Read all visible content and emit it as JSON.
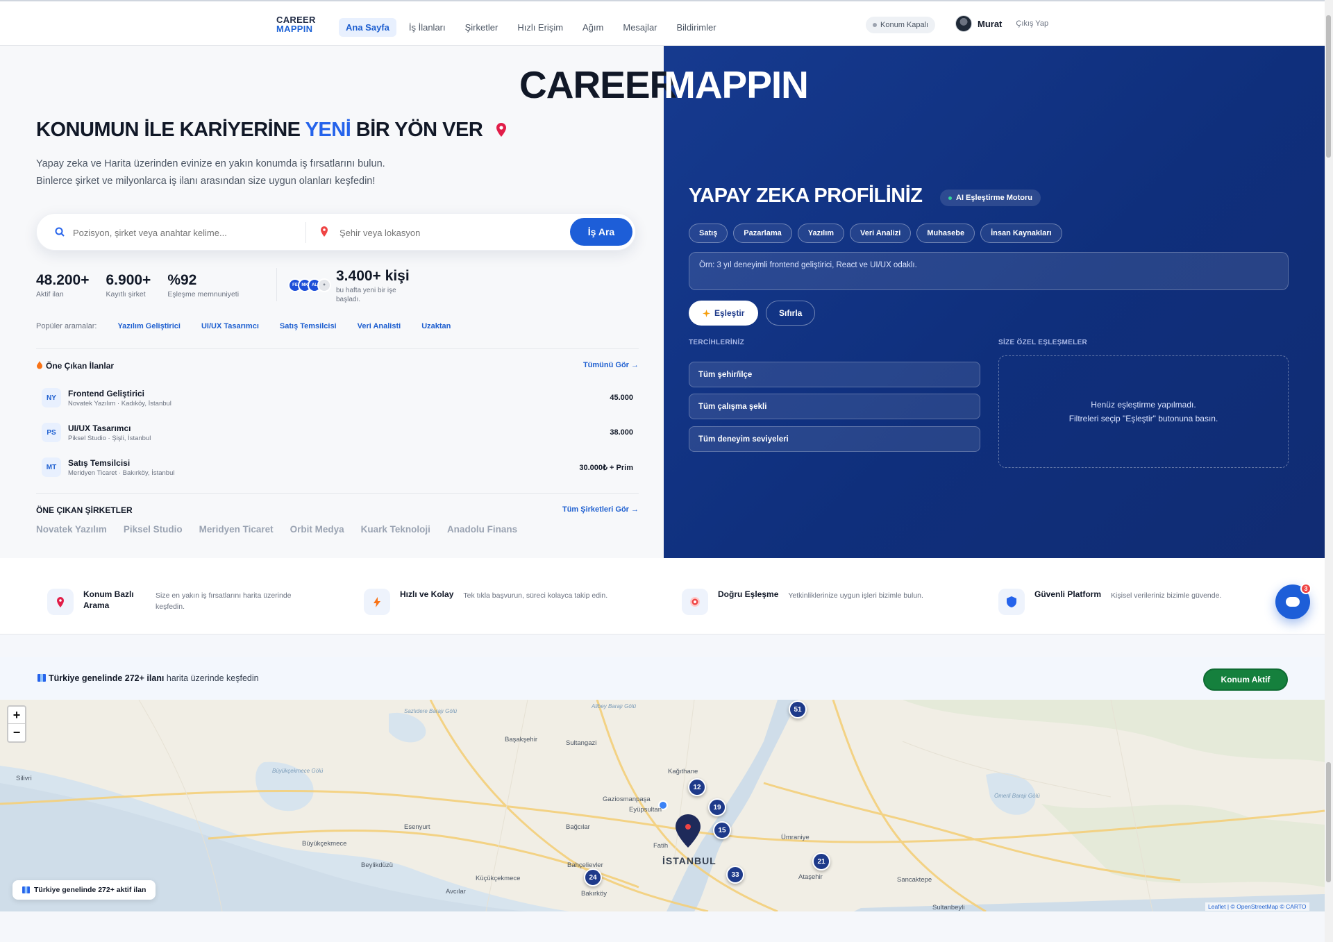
{
  "nav": {
    "logo_line1": "CAREER",
    "logo_line2": "MAPPIN",
    "links": [
      "Ana Sayfa",
      "İş İlanları",
      "Şirketler",
      "Hızlı Erişim",
      "Ağım",
      "Mesajlar",
      "Bildirimler"
    ],
    "location_status": "Konum Kapalı",
    "user_name": "Murat",
    "logout": "Çıkış Yap"
  },
  "hero": {
    "brand_left": "CAREER",
    "brand_right": "MAPPIN",
    "headline_a": "KONUMUN İLE KARİYERİNE ",
    "headline_highlight": "YENİ",
    "headline_b": " BİR YÖN VER",
    "subtitle_1": "Yapay zeka ve Harita üzerinden evinize en yakın konumda iş fırsatlarını bulun.",
    "subtitle_2": "Binlerce şirket ve milyonlarca iş ilanı arasından size uygun olanları keşfedin!",
    "search_placeholder": "Pozisyon, şirket veya anahtar kelime...",
    "location_placeholder": "Şehir veya lokasyon",
    "search_button": "İş Ara"
  },
  "stats": [
    {
      "value": "48.200+",
      "label": "Aktif ilan"
    },
    {
      "value": "6.900+",
      "label": "Kayıtlı şirket"
    },
    {
      "value": "%92",
      "label": "Eşleşme memnuniyeti"
    }
  ],
  "joined": {
    "avatars": [
      "FE",
      "MK",
      "AL",
      "+"
    ],
    "value": "3.400+ kişi",
    "label": "bu hafta yeni bir işe başladı."
  },
  "popular": {
    "label": "Popüler aramalar:",
    "tags": [
      "Yazılım Geliştirici",
      "UI/UX Tasarımcı",
      "Satış Temsilcisi",
      "Veri Analisti",
      "Uzaktan"
    ]
  },
  "featured_jobs": {
    "title": "Öne Çıkan İlanlar",
    "see_all": "Tümünü Gör →",
    "items": [
      {
        "badge": "NY",
        "title": "Frontend Geliştirici",
        "sub": "Novatek Yazılım · Kadıköy, İstanbul",
        "salary": "45.000"
      },
      {
        "badge": "PS",
        "title": "UI/UX Tasarımcı",
        "sub": "Piksel Studio · Şişli, İstanbul",
        "salary": "38.000"
      },
      {
        "badge": "MT",
        "title": "Satış Temsilcisi",
        "sub": "Meridyen Ticaret · Bakırköy, İstanbul",
        "salary": "30.000₺ + Prim"
      }
    ]
  },
  "featured_companies": {
    "title": "ÖNE ÇIKAN ŞİRKETLER",
    "see_all": "Tüm Şirketleri Gör →",
    "items": [
      "Novatek Yazılım",
      "Piksel Studio",
      "Meridyen Ticaret",
      "Orbit Medya",
      "Kuark Teknoloji",
      "Anadolu Finans"
    ]
  },
  "ai": {
    "title": "YAPAY ZEKA PROFİLİNİZ",
    "badge": "AI Eşleştirme Motoru",
    "chips": [
      "Satış",
      "Pazarlama",
      "Yazılım",
      "Veri Analizi",
      "Muhasebe",
      "İnsan Kaynakları"
    ],
    "textarea_placeholder": "Örn: 3 yıl deneyimli frontend geliştirici, React ve UI/UX odaklı.",
    "match_button": "Eşleştir",
    "reset_button": "Sıfırla",
    "prefs_title": "TERCİHLERİNİZ",
    "matches_title": "SİZE ÖZEL EŞLEŞMELER",
    "selects": [
      "Tüm şehir/ilçe",
      "Tüm çalışma şekli",
      "Tüm deneyim seviyeleri"
    ],
    "empty_1": "Henüz eşleştirme yapılmadı.",
    "empty_2": "Filtreleri seçip \"Eşleştir\" butonuna basın."
  },
  "features": [
    {
      "icon": "map-pin-icon",
      "title": "Konum Bazlı Arama",
      "desc": "Size en yakın iş fırsatlarını harita üzerinde keşfedin."
    },
    {
      "icon": "lightning-icon",
      "title": "Hızlı ve Kolay",
      "desc": "Tek tıkla başvurun, süreci kolayca takip edin."
    },
    {
      "icon": "target-icon",
      "title": "Doğru Eşleşme",
      "desc": "Yetkinliklerinize uygun işleri bizimle bulun."
    },
    {
      "icon": "shield-icon",
      "title": "Güvenli Platform",
      "desc": "Kişisel verileriniz bizimle güvende."
    }
  ],
  "chat": {
    "count": "3"
  },
  "map": {
    "bar_text_bold": "Türkiye genelinde 272+ ilanı",
    "bar_text_rest": " harita üzerinde keşfedin",
    "location_button": "Konum Aktif",
    "footer_badge": "Türkiye genelinde 272+ aktif ilan",
    "attribution": "Leaflet | © OpenStreetMap © CARTO",
    "zoom_in": "+",
    "zoom_out": "−",
    "clusters": [
      "51",
      "12",
      "19",
      "15",
      "24",
      "33",
      "21"
    ],
    "places": [
      "Sazlıdere Barajı Gölü",
      "Alibey Barajı Gölü",
      "Başakşehir",
      "Sultangazi",
      "Silivri",
      "Büyükçekmece Gölü",
      "Kağıthane",
      "Gaziosmanpaşa",
      "Eyüpsultan",
      "Esenyurt",
      "Bağcılar",
      "Büyükçekmece",
      "Fatih",
      "İSTANBUL",
      "Ümraniye",
      "Ömerli Barajı Gölü",
      "Beylikdüzü",
      "Bahçelievler",
      "Küçükçekmece",
      "Avcılar",
      "Bakırköy",
      "Ataşehir",
      "Sancaktepe",
      "Sultanbeyli"
    ]
  }
}
